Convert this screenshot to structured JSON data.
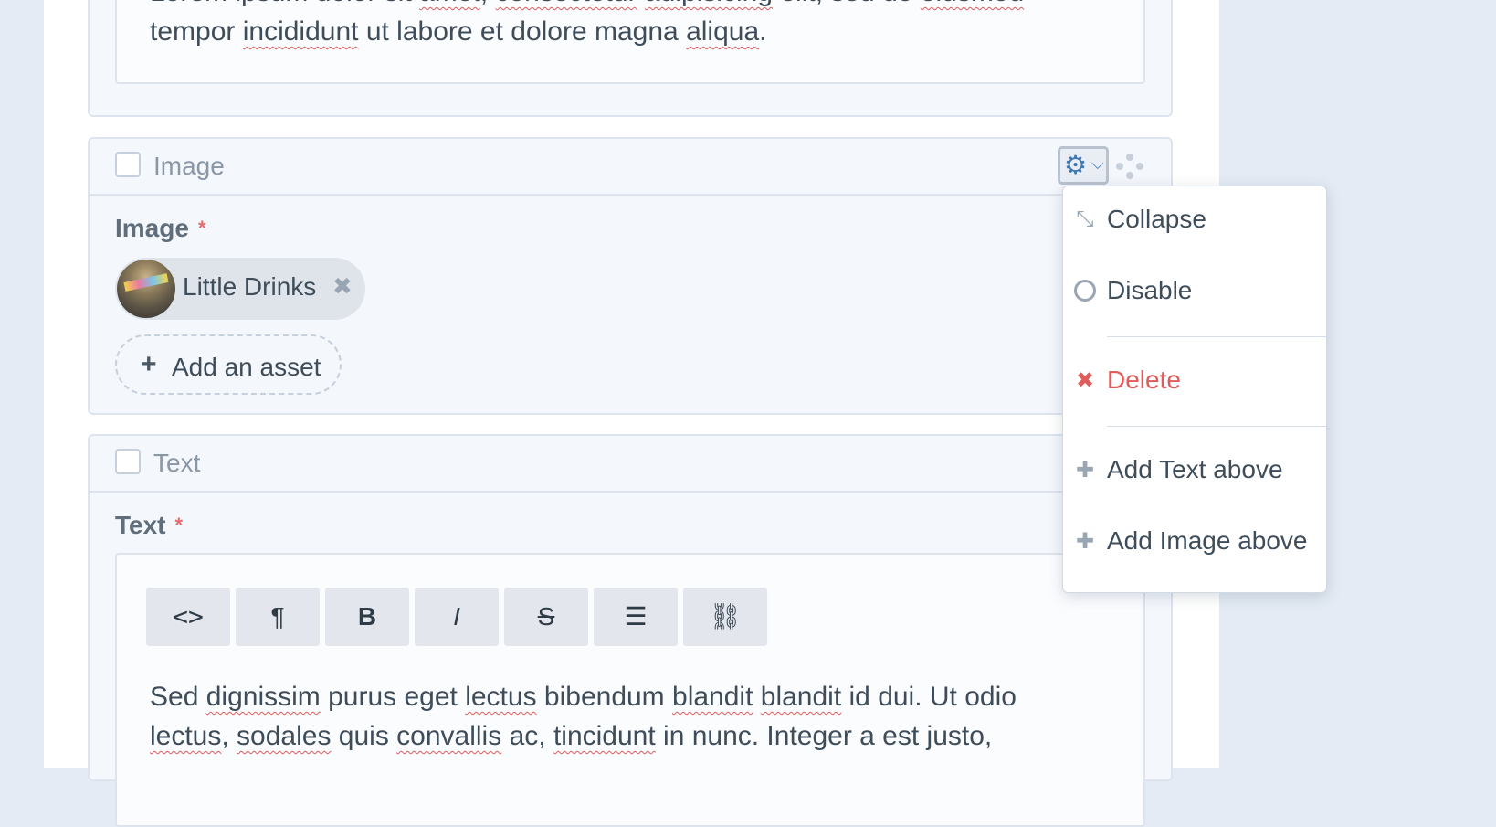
{
  "top_block": {
    "lines": [
      [
        "Lorem ipsum dolor sit ",
        {
          "w": "amet"
        },
        ", ",
        {
          "w": "consectetur"
        },
        " ",
        {
          "w": "adipisicing"
        },
        " elit, sed do ",
        {
          "w": "eiusmod"
        }
      ],
      [
        "tempor ",
        {
          "w": "incididunt"
        },
        " ut labore et dolore magna ",
        {
          "w": "aliqua"
        },
        "."
      ]
    ]
  },
  "image_block": {
    "title": "Image",
    "field_label": "Image",
    "required_mark": "*",
    "asset": {
      "name": "Little Drinks",
      "remove_icon": "✖"
    },
    "add_asset": {
      "icon": "+",
      "label": "Add an asset"
    },
    "settings_icon": "⚙",
    "settings_chevron": "⌵"
  },
  "text_block": {
    "title": "Text",
    "field_label": "Text",
    "required_mark": "*",
    "toolbar": [
      {
        "name": "code-button",
        "icon": "<>"
      },
      {
        "name": "paragraph-button",
        "icon": "¶"
      },
      {
        "name": "bold-button",
        "icon": "B"
      },
      {
        "name": "italic-button",
        "icon": "I"
      },
      {
        "name": "strikethrough-button",
        "icon": "S"
      },
      {
        "name": "bullet-list-button",
        "icon": "☰"
      },
      {
        "name": "link-button",
        "icon": "⛓"
      }
    ],
    "lines": [
      [
        "Sed ",
        {
          "w": "dignissim"
        },
        " purus eget ",
        {
          "w": "lectus"
        },
        " bibendum ",
        {
          "w": "blandit"
        },
        " ",
        {
          "w": "blandit"
        },
        " id dui. Ut odio"
      ],
      [
        {
          "w": "lectus"
        },
        ", ",
        {
          "w": "sodales"
        },
        " quis ",
        {
          "w": "convallis"
        },
        " ac, ",
        {
          "w": "tincidunt"
        },
        " in nunc. Integer a est justo,"
      ]
    ]
  },
  "menu": {
    "items": [
      {
        "name": "menu-item-collapse",
        "icon_name": "collapse-icon",
        "icon": "⤡",
        "label": "Collapse",
        "variant": "normal"
      },
      {
        "name": "menu-item-disable",
        "icon_name": "circle-icon",
        "icon": "○",
        "label": "Disable",
        "variant": "normal"
      },
      {
        "name": "menu-item-delete",
        "icon_name": "x-icon",
        "icon": "✖",
        "label": "Delete",
        "variant": "danger"
      },
      {
        "name": "menu-item-add-text-above",
        "icon_name": "plus-icon",
        "icon": "✚",
        "label": "Add Text above",
        "variant": "normal"
      },
      {
        "name": "menu-item-add-image-above",
        "icon_name": "plus-icon",
        "icon": "✚",
        "label": "Add Image above",
        "variant": "normal"
      }
    ]
  },
  "colors": {
    "background": "#e4ebf4",
    "accent": "#3f77b5",
    "danger": "#e05b5b",
    "required": "#e06e6e"
  }
}
